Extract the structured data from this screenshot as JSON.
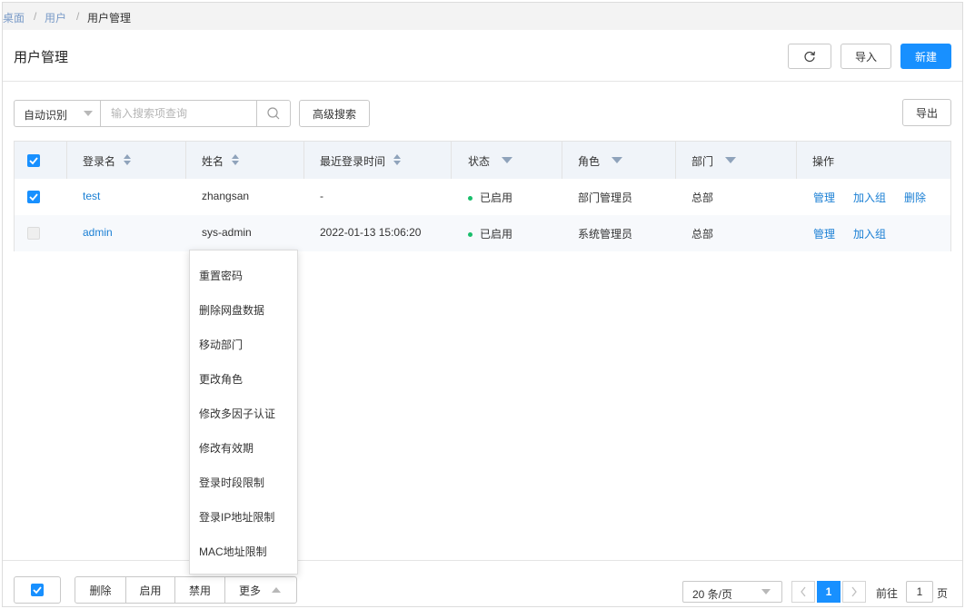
{
  "breadcrumb": {
    "items": [
      "桌面",
      "用户",
      "用户管理"
    ],
    "separator": "/"
  },
  "page": {
    "title": "用户管理"
  },
  "header_actions": {
    "refresh_icon": "refresh-icon",
    "import_label": "导入",
    "new_label": "新建"
  },
  "search": {
    "mode_value": "自动识别",
    "placeholder": "输入搜索项查询",
    "value": "",
    "advanced_label": "高级搜索",
    "export_label": "导出"
  },
  "table": {
    "columns": [
      {
        "label": "",
        "kind": "checkbox"
      },
      {
        "label": "登录名",
        "kind": "sortable"
      },
      {
        "label": "姓名",
        "kind": "sortable"
      },
      {
        "label": "最近登录时间",
        "kind": "sortable"
      },
      {
        "label": "状态",
        "kind": "filter"
      },
      {
        "label": "角色",
        "kind": "filter"
      },
      {
        "label": "部门",
        "kind": "filter"
      },
      {
        "label": "操作",
        "kind": "plain"
      }
    ],
    "header_checked": true,
    "rows": [
      {
        "checked": true,
        "login": "test",
        "name": "zhangsan",
        "last_login": "-",
        "status": "已启用",
        "role": "部门管理员",
        "dept": "总部",
        "actions": [
          "管理",
          "加入组",
          "删除"
        ]
      },
      {
        "checked": false,
        "login": "admin",
        "name": "sys-admin",
        "last_login": "2022-01-13 15:06:20",
        "status": "已启用",
        "role": "系统管理员",
        "dept": "总部",
        "actions": [
          "管理",
          "加入组"
        ]
      }
    ]
  },
  "more_menu": {
    "items": [
      "重置密码",
      "删除网盘数据",
      "移动部门",
      "更改角色",
      "修改多因子认证",
      "修改有效期",
      "登录时段限制",
      "登录IP地址限制",
      "MAC地址限制"
    ]
  },
  "footer": {
    "select_all_checked": true,
    "bulk_buttons": [
      "删除",
      "启用",
      "禁用"
    ],
    "more_label": "更多",
    "page_size": "20 条/页",
    "current_page": "1",
    "goto_prefix": "前往",
    "goto_value": "1",
    "goto_suffix": "页"
  },
  "colors": {
    "accent": "#1890ff",
    "link": "#1a7fd4",
    "status_enabled": "#19be6b",
    "header_bg": "#f0f4f9",
    "breadcrumb_bar": "#f3f3f3"
  }
}
